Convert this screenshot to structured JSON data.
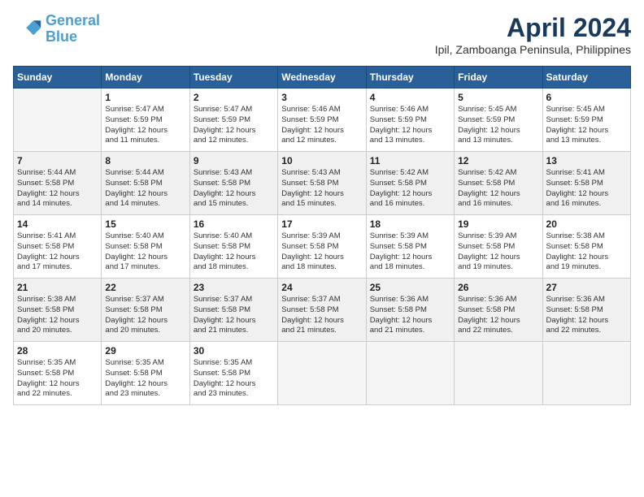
{
  "header": {
    "logo_line1": "General",
    "logo_line2": "Blue",
    "month": "April 2024",
    "location": "Ipil, Zamboanga Peninsula, Philippines"
  },
  "weekdays": [
    "Sunday",
    "Monday",
    "Tuesday",
    "Wednesday",
    "Thursday",
    "Friday",
    "Saturday"
  ],
  "weeks": [
    [
      {
        "day": "",
        "info": ""
      },
      {
        "day": "1",
        "info": "Sunrise: 5:47 AM\nSunset: 5:59 PM\nDaylight: 12 hours\nand 11 minutes."
      },
      {
        "day": "2",
        "info": "Sunrise: 5:47 AM\nSunset: 5:59 PM\nDaylight: 12 hours\nand 12 minutes."
      },
      {
        "day": "3",
        "info": "Sunrise: 5:46 AM\nSunset: 5:59 PM\nDaylight: 12 hours\nand 12 minutes."
      },
      {
        "day": "4",
        "info": "Sunrise: 5:46 AM\nSunset: 5:59 PM\nDaylight: 12 hours\nand 13 minutes."
      },
      {
        "day": "5",
        "info": "Sunrise: 5:45 AM\nSunset: 5:59 PM\nDaylight: 12 hours\nand 13 minutes."
      },
      {
        "day": "6",
        "info": "Sunrise: 5:45 AM\nSunset: 5:59 PM\nDaylight: 12 hours\nand 13 minutes."
      }
    ],
    [
      {
        "day": "7",
        "info": "Sunrise: 5:44 AM\nSunset: 5:58 PM\nDaylight: 12 hours\nand 14 minutes."
      },
      {
        "day": "8",
        "info": "Sunrise: 5:44 AM\nSunset: 5:58 PM\nDaylight: 12 hours\nand 14 minutes."
      },
      {
        "day": "9",
        "info": "Sunrise: 5:43 AM\nSunset: 5:58 PM\nDaylight: 12 hours\nand 15 minutes."
      },
      {
        "day": "10",
        "info": "Sunrise: 5:43 AM\nSunset: 5:58 PM\nDaylight: 12 hours\nand 15 minutes."
      },
      {
        "day": "11",
        "info": "Sunrise: 5:42 AM\nSunset: 5:58 PM\nDaylight: 12 hours\nand 16 minutes."
      },
      {
        "day": "12",
        "info": "Sunrise: 5:42 AM\nSunset: 5:58 PM\nDaylight: 12 hours\nand 16 minutes."
      },
      {
        "day": "13",
        "info": "Sunrise: 5:41 AM\nSunset: 5:58 PM\nDaylight: 12 hours\nand 16 minutes."
      }
    ],
    [
      {
        "day": "14",
        "info": "Sunrise: 5:41 AM\nSunset: 5:58 PM\nDaylight: 12 hours\nand 17 minutes."
      },
      {
        "day": "15",
        "info": "Sunrise: 5:40 AM\nSunset: 5:58 PM\nDaylight: 12 hours\nand 17 minutes."
      },
      {
        "day": "16",
        "info": "Sunrise: 5:40 AM\nSunset: 5:58 PM\nDaylight: 12 hours\nand 18 minutes."
      },
      {
        "day": "17",
        "info": "Sunrise: 5:39 AM\nSunset: 5:58 PM\nDaylight: 12 hours\nand 18 minutes."
      },
      {
        "day": "18",
        "info": "Sunrise: 5:39 AM\nSunset: 5:58 PM\nDaylight: 12 hours\nand 18 minutes."
      },
      {
        "day": "19",
        "info": "Sunrise: 5:39 AM\nSunset: 5:58 PM\nDaylight: 12 hours\nand 19 minutes."
      },
      {
        "day": "20",
        "info": "Sunrise: 5:38 AM\nSunset: 5:58 PM\nDaylight: 12 hours\nand 19 minutes."
      }
    ],
    [
      {
        "day": "21",
        "info": "Sunrise: 5:38 AM\nSunset: 5:58 PM\nDaylight: 12 hours\nand 20 minutes."
      },
      {
        "day": "22",
        "info": "Sunrise: 5:37 AM\nSunset: 5:58 PM\nDaylight: 12 hours\nand 20 minutes."
      },
      {
        "day": "23",
        "info": "Sunrise: 5:37 AM\nSunset: 5:58 PM\nDaylight: 12 hours\nand 21 minutes."
      },
      {
        "day": "24",
        "info": "Sunrise: 5:37 AM\nSunset: 5:58 PM\nDaylight: 12 hours\nand 21 minutes."
      },
      {
        "day": "25",
        "info": "Sunrise: 5:36 AM\nSunset: 5:58 PM\nDaylight: 12 hours\nand 21 minutes."
      },
      {
        "day": "26",
        "info": "Sunrise: 5:36 AM\nSunset: 5:58 PM\nDaylight: 12 hours\nand 22 minutes."
      },
      {
        "day": "27",
        "info": "Sunrise: 5:36 AM\nSunset: 5:58 PM\nDaylight: 12 hours\nand 22 minutes."
      }
    ],
    [
      {
        "day": "28",
        "info": "Sunrise: 5:35 AM\nSunset: 5:58 PM\nDaylight: 12 hours\nand 22 minutes."
      },
      {
        "day": "29",
        "info": "Sunrise: 5:35 AM\nSunset: 5:58 PM\nDaylight: 12 hours\nand 23 minutes."
      },
      {
        "day": "30",
        "info": "Sunrise: 5:35 AM\nSunset: 5:58 PM\nDaylight: 12 hours\nand 23 minutes."
      },
      {
        "day": "",
        "info": ""
      },
      {
        "day": "",
        "info": ""
      },
      {
        "day": "",
        "info": ""
      },
      {
        "day": "",
        "info": ""
      }
    ]
  ]
}
